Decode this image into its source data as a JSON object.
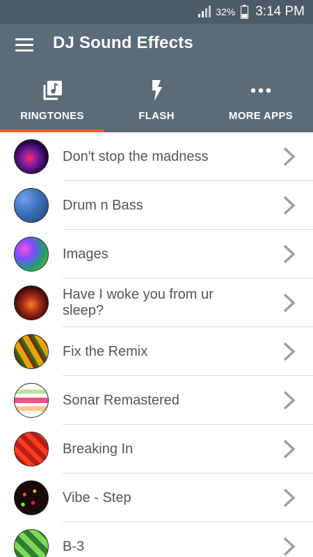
{
  "status_bar": {
    "battery_percent": "32%",
    "time": "3:14 PM"
  },
  "app_bar": {
    "title": "DJ Sound Effects"
  },
  "tabs": [
    {
      "label": "RINGTONES",
      "icon": "music-library-icon",
      "selected": true
    },
    {
      "label": "FLASH",
      "icon": "flash-icon",
      "selected": false
    },
    {
      "label": "MORE APPS",
      "icon": "more-dots-icon",
      "selected": false
    }
  ],
  "colors": {
    "status_bar_bg": "#4e5b66",
    "app_bar_bg": "#5b6b77",
    "tab_indicator": "#ff5722",
    "list_text": "#555555",
    "chevron": "#9e9e9e"
  },
  "ringtones": [
    {
      "title": "Don't stop the madness"
    },
    {
      "title": "Drum n Bass"
    },
    {
      "title": "Images"
    },
    {
      "title": "Have I woke you from ur sleep?"
    },
    {
      "title": "Fix the Remix"
    },
    {
      "title": "Sonar Remastered"
    },
    {
      "title": "Breaking In"
    },
    {
      "title": "Vibe - Step"
    },
    {
      "title": "B-3"
    }
  ]
}
